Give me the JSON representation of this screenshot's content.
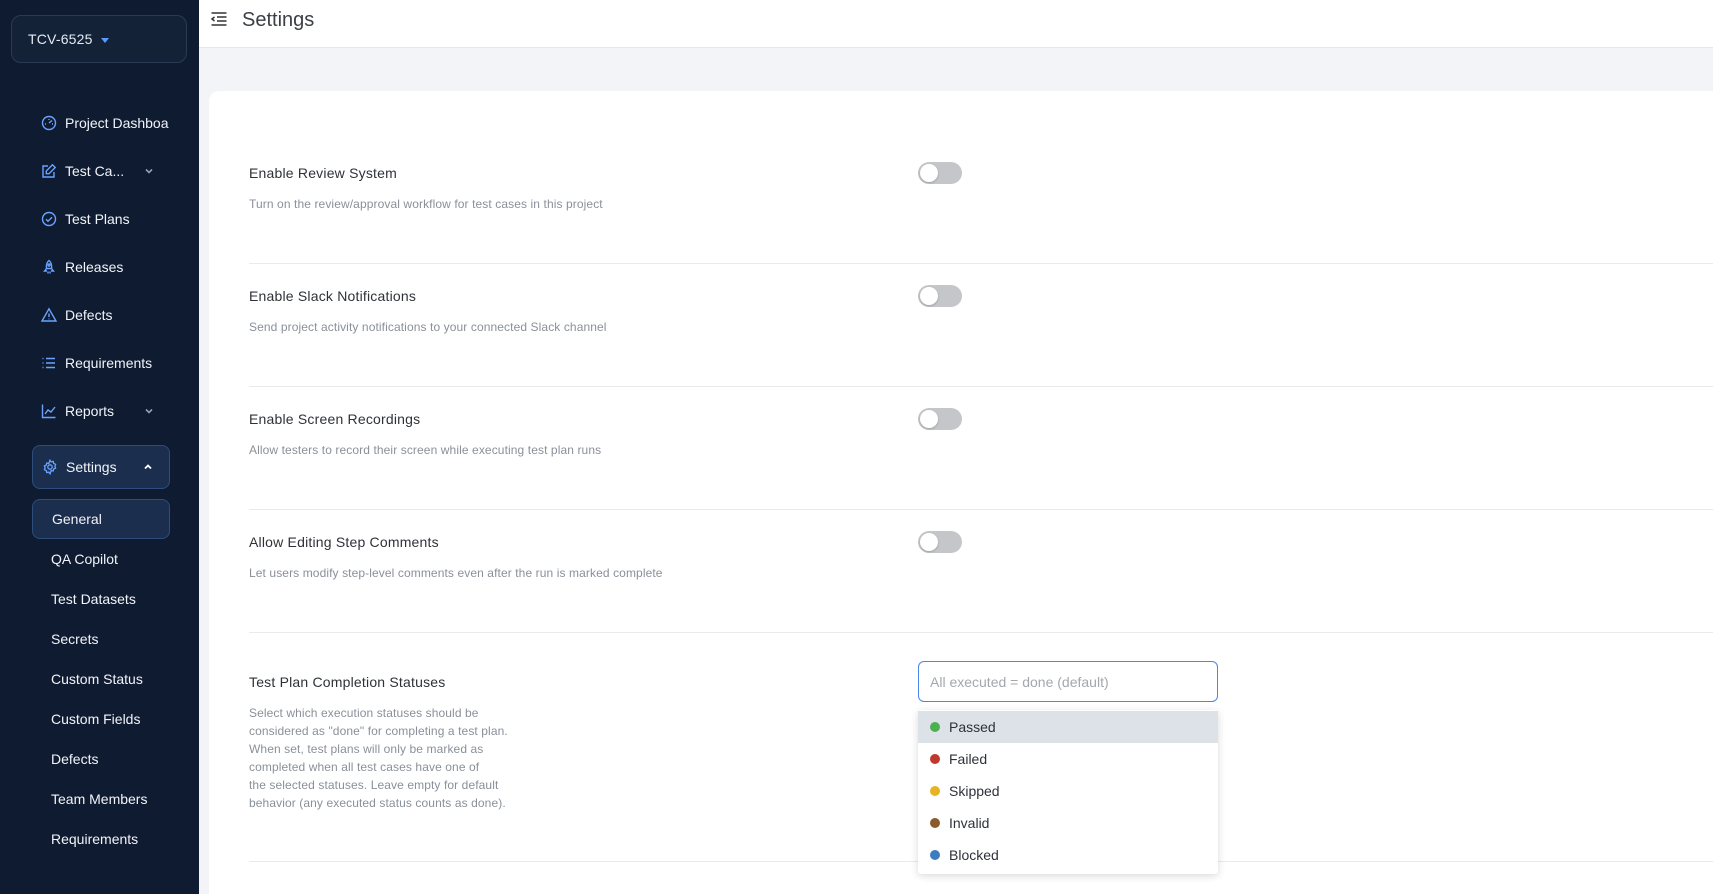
{
  "project": {
    "name": "TCV-6525"
  },
  "header": {
    "title": "Settings"
  },
  "sidebar": {
    "items": [
      {
        "label": "Project Dashboa",
        "icon": "dashboard-icon"
      },
      {
        "label": "Test Ca...",
        "icon": "edit-icon",
        "expandable": true
      },
      {
        "label": "Test Plans",
        "icon": "check-circle-icon"
      },
      {
        "label": "Releases",
        "icon": "rocket-icon"
      },
      {
        "label": "Defects",
        "icon": "warning-icon"
      },
      {
        "label": "Requirements",
        "icon": "list-icon"
      },
      {
        "label": "Reports",
        "icon": "chart-icon",
        "expandable": true
      },
      {
        "label": "Settings",
        "icon": "gear-icon",
        "expanded": true,
        "active": true
      }
    ],
    "settings_sub": [
      {
        "label": "General",
        "active": true
      },
      {
        "label": "QA Copilot"
      },
      {
        "label": "Test Datasets"
      },
      {
        "label": "Secrets"
      },
      {
        "label": "Custom Status"
      },
      {
        "label": "Custom Fields"
      },
      {
        "label": "Defects"
      },
      {
        "label": "Team Members"
      },
      {
        "label": "Requirements"
      }
    ]
  },
  "settings": [
    {
      "title": "Enable Review System",
      "desc": "Turn on the review/approval workflow for test cases in this project",
      "enabled": false
    },
    {
      "title": "Enable Slack Notifications",
      "desc": "Send project activity notifications to your connected Slack channel",
      "enabled": false
    },
    {
      "title": "Enable Screen Recordings",
      "desc": "Allow testers to record their screen while executing test plan runs",
      "enabled": false
    },
    {
      "title": "Allow Editing Step Comments",
      "desc": "Let users modify step-level comments even after the run is marked complete",
      "enabled": false
    }
  ],
  "completion": {
    "title": "Test Plan Completion Statuses",
    "desc_lines": [
      "Select which execution statuses should be",
      "considered as \"done\" for completing a test plan.",
      "When set, test plans will only be marked as",
      "completed when all test cases have one of",
      "the selected statuses. Leave empty for default",
      "behavior (any executed status counts as done)."
    ],
    "placeholder": "All executed = done (default)",
    "options": [
      {
        "label": "Passed",
        "color": "#4caf50"
      },
      {
        "label": "Failed",
        "color": "#c0392b"
      },
      {
        "label": "Skipped",
        "color": "#e6b422"
      },
      {
        "label": "Invalid",
        "color": "#8b5a2b"
      },
      {
        "label": "Blocked",
        "color": "#3d7dbf"
      }
    ],
    "highlighted_index": 0
  },
  "colors": {
    "sidebar_bg": "#0f1b30",
    "accent": "#4a86e8",
    "icon": "#6aa3ff"
  }
}
